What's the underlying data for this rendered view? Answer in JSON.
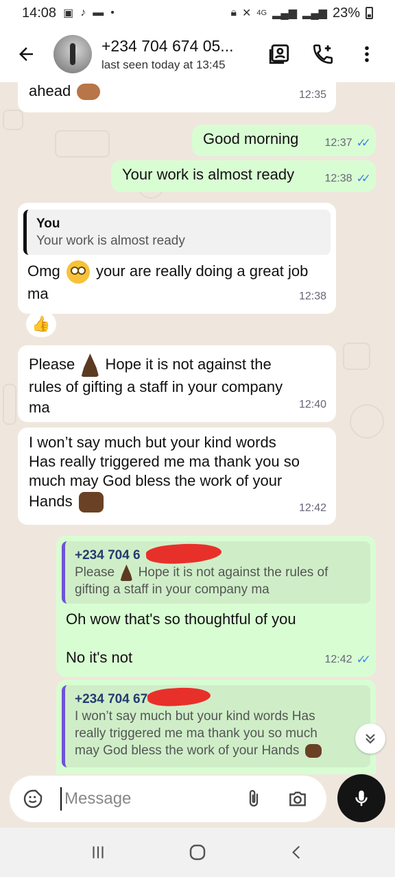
{
  "status_bar": {
    "time": "14:08",
    "network": "4G",
    "battery": "23%",
    "dot": "•"
  },
  "header": {
    "contact_name": "+234 704 674 05...",
    "last_seen": "last seen today at 13:45",
    "icons": [
      "back-arrow-icon",
      "contact-card-icon",
      "add-call-icon",
      "more-vert-icon"
    ]
  },
  "messages": {
    "m1": {
      "text": "ahead",
      "time": "12:35",
      "emoji": "heart-hands"
    },
    "m2": {
      "text": "Good morning",
      "time": "12:37",
      "ticks": "✓✓"
    },
    "m3": {
      "text": "Your work is almost ready",
      "time": "12:38",
      "ticks": "✓✓"
    },
    "m4": {
      "quote_author": "You",
      "quote_text": "Your work is almost ready",
      "text_a": "Omg",
      "text_b": "your are really doing a great job",
      "text_c": "ma",
      "time": "12:38",
      "reaction": "👍"
    },
    "m5": {
      "text_a": "Please",
      "text_b": "Hope it is not against the",
      "text_c": "rules of gifting a staff in your company",
      "text_d": "ma",
      "time": "12:40"
    },
    "m6": {
      "line1": "I won’t say much but your kind words",
      "line2": "Has really triggered me ma thank you so",
      "line3": "much may God bless the work of your",
      "line4": "Hands",
      "time": "12:42"
    },
    "m7": {
      "quote_author": "+234 704 6",
      "quote_text_a": "Please",
      "quote_text_b": "Hope it is not against the rules of",
      "quote_text_c": "gifting a staff in your company ma",
      "line1": "Oh wow that's so thoughtful of you",
      "line2": "No it's not",
      "time": "12:42",
      "ticks": "✓✓"
    },
    "m8": {
      "quote_author": "+234 704 67",
      "quote_line1": "I won’t say much but your kind words Has",
      "quote_line2": "really triggered me ma thank you so much",
      "quote_line3": "may God bless the work of your Hands"
    }
  },
  "composer": {
    "placeholder": "Message",
    "icons": [
      "sticker-icon",
      "attach-icon",
      "camera-icon",
      "mic-icon"
    ]
  },
  "colors": {
    "wallpaper": "#efe7dd",
    "incoming": "#ffffff",
    "outgoing": "#d9fdd3",
    "read_ticks": "#3b87e0",
    "quote_bar": "#6e52d8"
  }
}
